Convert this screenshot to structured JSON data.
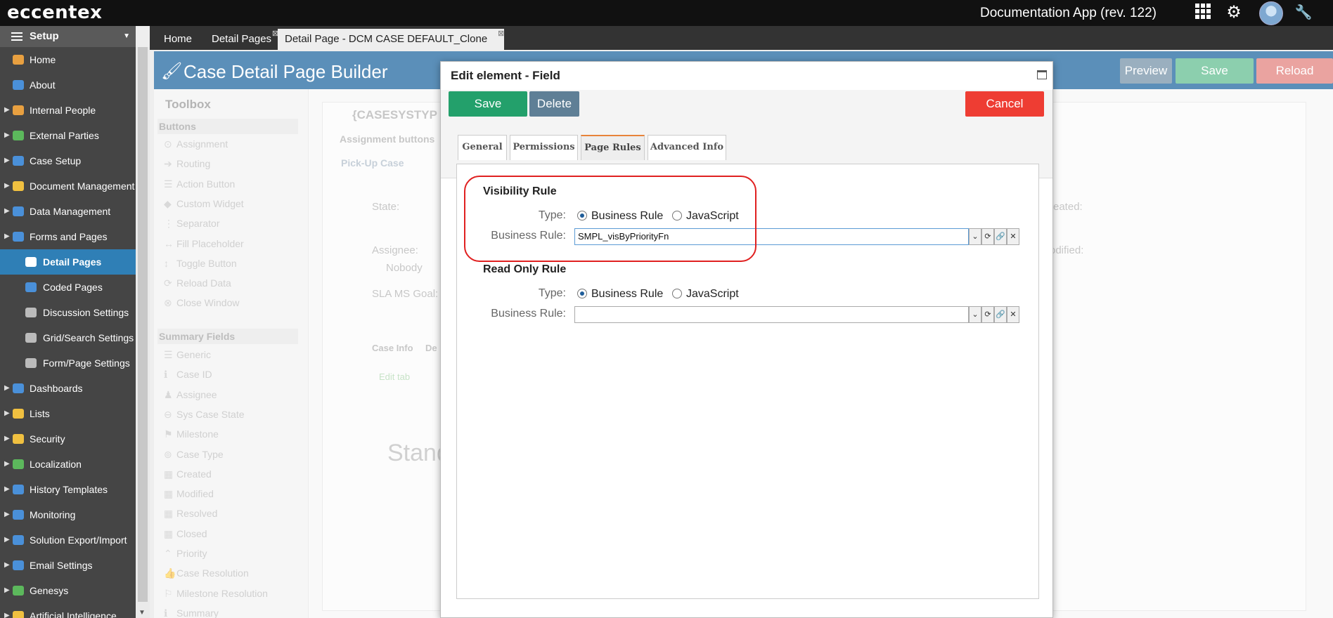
{
  "topbar": {
    "logo": "eccentex",
    "app_title": "Documentation App (rev. 122)"
  },
  "sidebar": {
    "header": "Setup",
    "items": [
      {
        "label": "Home",
        "icon": "home-icon",
        "color": "#e8a040",
        "arrow": false,
        "indent": false
      },
      {
        "label": "About",
        "icon": "info-icon",
        "color": "#4a90d9",
        "arrow": false,
        "indent": false
      },
      {
        "label": "Internal People",
        "icon": "people-icon",
        "color": "#e8a040",
        "arrow": true,
        "indent": false
      },
      {
        "label": "External Parties",
        "icon": "globe-icon",
        "color": "#5cb85c",
        "arrow": true,
        "indent": false
      },
      {
        "label": "Case Setup",
        "icon": "case-setup-icon",
        "color": "#4a90d9",
        "arrow": true,
        "indent": false
      },
      {
        "label": "Document Management",
        "icon": "document-icon",
        "color": "#f0c040",
        "arrow": true,
        "indent": false
      },
      {
        "label": "Data Management",
        "icon": "table-icon",
        "color": "#4a90d9",
        "arrow": true,
        "indent": false
      },
      {
        "label": "Forms and Pages",
        "icon": "forms-icon",
        "color": "#4a90d9",
        "arrow": true,
        "indent": false
      },
      {
        "label": "Detail Pages",
        "icon": "pages-icon",
        "color": "#ffffff",
        "arrow": false,
        "indent": true,
        "active": true
      },
      {
        "label": "Coded Pages",
        "icon": "code-icon",
        "color": "#4a90d9",
        "arrow": false,
        "indent": true
      },
      {
        "label": "Discussion Settings",
        "icon": "gear-icon",
        "color": "#bbbbbb",
        "arrow": false,
        "indent": true
      },
      {
        "label": "Grid/Search Settings",
        "icon": "gear-icon",
        "color": "#bbbbbb",
        "arrow": false,
        "indent": true
      },
      {
        "label": "Form/Page Settings",
        "icon": "gear-icon",
        "color": "#bbbbbb",
        "arrow": false,
        "indent": true
      },
      {
        "label": "Dashboards",
        "icon": "dashboard-icon",
        "color": "#4a90d9",
        "arrow": true,
        "indent": false
      },
      {
        "label": "Lists",
        "icon": "lists-icon",
        "color": "#f0c040",
        "arrow": true,
        "indent": false
      },
      {
        "label": "Security",
        "icon": "lock-icon",
        "color": "#f0c040",
        "arrow": true,
        "indent": false
      },
      {
        "label": "Localization",
        "icon": "globe-icon",
        "color": "#5cb85c",
        "arrow": true,
        "indent": false
      },
      {
        "label": "History Templates",
        "icon": "history-icon",
        "color": "#4a90d9",
        "arrow": true,
        "indent": false
      },
      {
        "label": "Monitoring",
        "icon": "monitor-icon",
        "color": "#4a90d9",
        "arrow": true,
        "indent": false
      },
      {
        "label": "Solution Export/Import",
        "icon": "export-icon",
        "color": "#4a90d9",
        "arrow": true,
        "indent": false
      },
      {
        "label": "Email Settings",
        "icon": "email-icon",
        "color": "#4a90d9",
        "arrow": true,
        "indent": false
      },
      {
        "label": "Genesys",
        "icon": "puzzle-icon",
        "color": "#5cb85c",
        "arrow": true,
        "indent": false
      },
      {
        "label": "Artificial Intelligence",
        "icon": "ai-icon",
        "color": "#f0c040",
        "arrow": true,
        "indent": false
      }
    ]
  },
  "tabs": {
    "home": "Home",
    "detail_pages": "Detail Pages",
    "active": "Detail Page - DCM CASE DEFAULT_Clone"
  },
  "page": {
    "title": "Case Detail Page Builder",
    "preview": "Preview",
    "save": "Save",
    "reload": "Reload"
  },
  "toolbox": {
    "title": "Toolbox",
    "buttons_section": "Buttons",
    "buttons": [
      "Assignment",
      "Routing",
      "Action Button",
      "Custom Widget",
      "Separator",
      "Fill Placeholder",
      "Toggle Button",
      "Reload Data",
      "Close Window"
    ],
    "summary_section": "Summary Fields",
    "summary": [
      "Generic",
      "Case ID",
      "Assignee",
      "Sys Case State",
      "Milestone",
      "Case Type",
      "Created",
      "Modified",
      "Resolved",
      "Closed",
      "Priority",
      "Case Resolution",
      "Milestone Resolution",
      "Summary"
    ]
  },
  "canvas": {
    "header": "{CASESYSTYP",
    "assignment_buttons": "Assignment buttons",
    "pickup": "Pick-Up Case",
    "state": "State:",
    "assignee": "Assignee:",
    "nobody": "Nobody",
    "sla": "SLA MS Goal:",
    "created": "reated:",
    "modified": "odified:",
    "case_info": "Case Info",
    "tab2": "De",
    "edit_tab": "Edit tab",
    "stand": "Stand"
  },
  "modal": {
    "title": "Edit element - Field",
    "save": "Save",
    "delete": "Delete",
    "cancel": "Cancel",
    "tabs": [
      "General",
      "Permissions",
      "Page Rules",
      "Advanced Info"
    ],
    "active_tab": "Page Rules",
    "visibility": {
      "title": "Visibility Rule",
      "type_label": "Type:",
      "option_business": "Business Rule",
      "option_js": "JavaScript",
      "selected": "Business Rule",
      "rule_label": "Business Rule:",
      "rule_value": "SMPL_visByPriorityFn"
    },
    "readonly": {
      "title": "Read Only Rule",
      "type_label": "Type:",
      "option_business": "Business Rule",
      "option_js": "JavaScript",
      "selected": "Business Rule",
      "rule_label": "Business Rule:",
      "rule_value": ""
    }
  },
  "colors": {
    "save_green": "#23a06b",
    "delete_gray": "#5f7f96",
    "cancel_red": "#ee3d33",
    "header_blue": "#5b8fb9",
    "active_sidebar": "#2f7fb6",
    "highlight_red": "#e02020"
  }
}
